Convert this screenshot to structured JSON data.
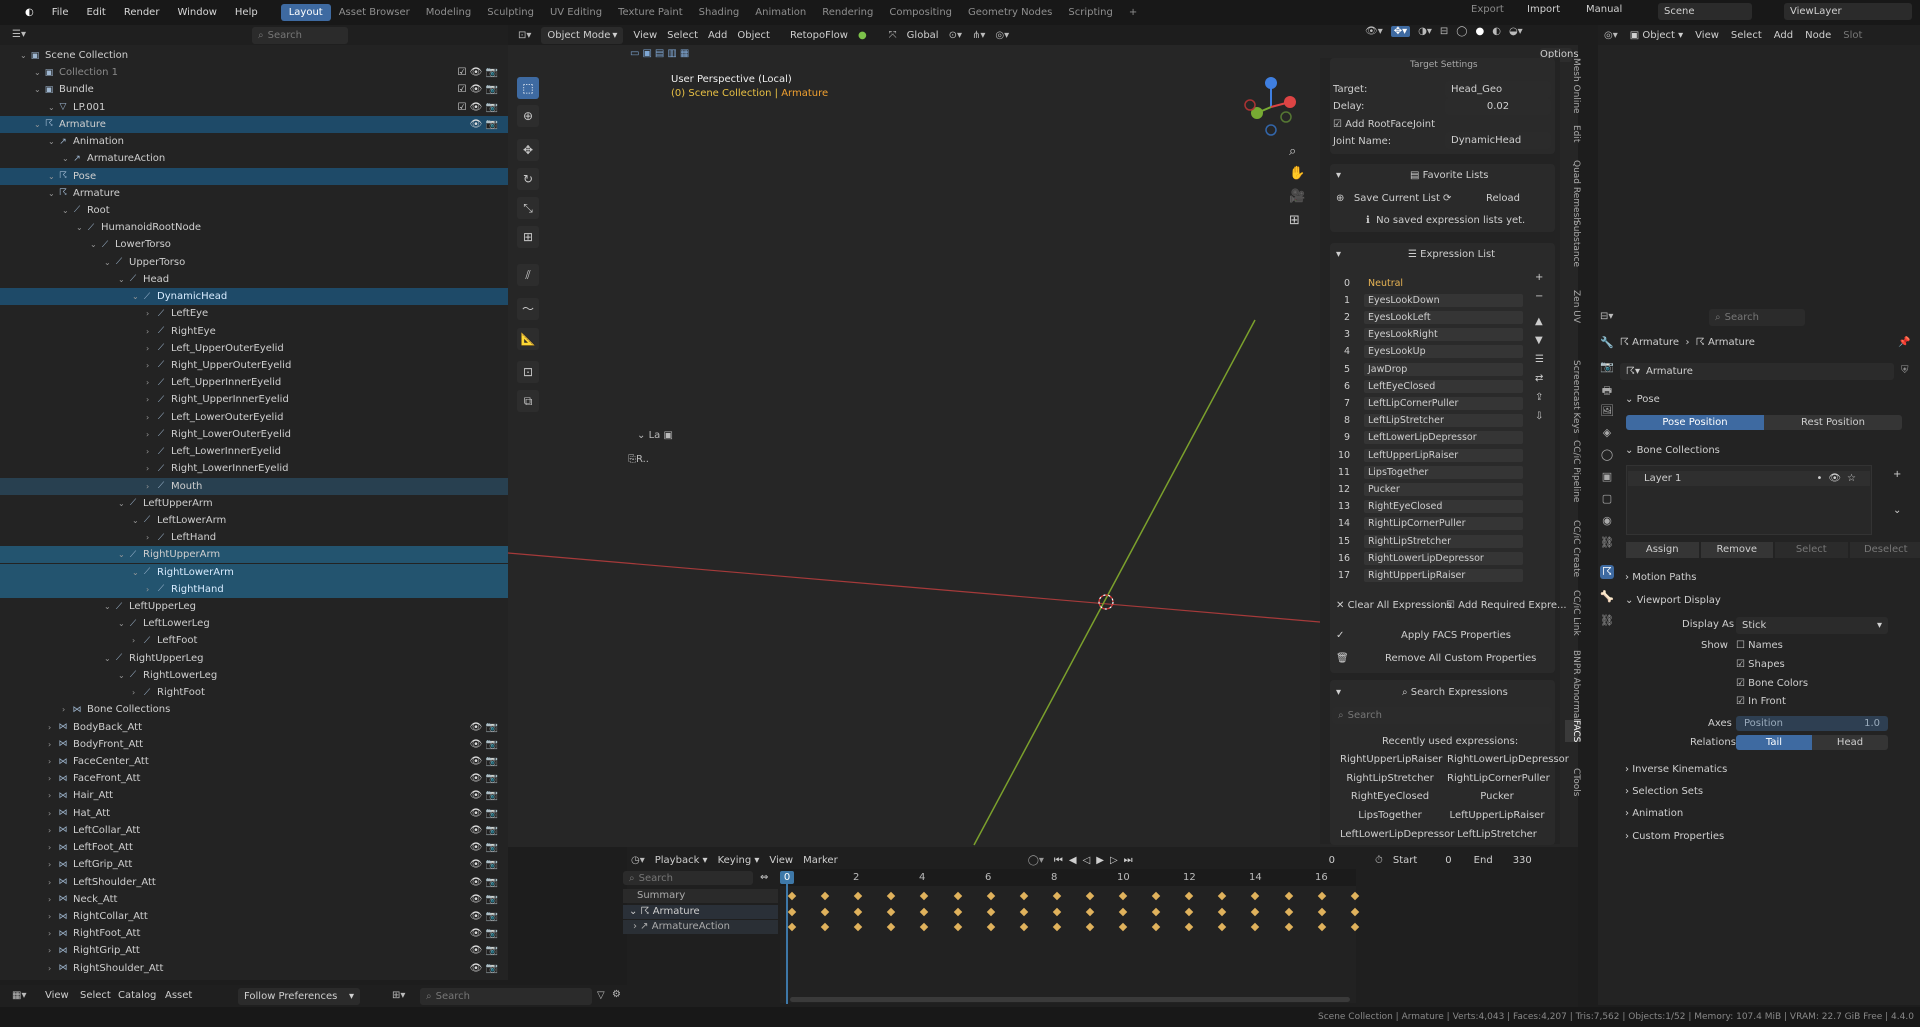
{
  "menu": [
    "File",
    "Edit",
    "Render",
    "Window",
    "Help"
  ],
  "workspaces": [
    "Layout",
    "Asset Browser",
    "Modeling",
    "Sculpting",
    "UV Editing",
    "Texture Paint",
    "Shading",
    "Animation",
    "Rendering",
    "Compositing",
    "Geometry Nodes",
    "Scripting"
  ],
  "topright": {
    "export": "Export",
    "import": "Import",
    "manual": "Manual",
    "scene": "Scene",
    "viewlayer": "ViewLayer"
  },
  "outliner": {
    "search_placeholder": "Search",
    "rows": [
      {
        "label": "Scene Collection",
        "indent": 0
      },
      {
        "label": "Collection 1",
        "indent": 1
      },
      {
        "label": "Bundle",
        "indent": 1
      },
      {
        "label": "LP.001",
        "indent": 2
      },
      {
        "label": "Armature",
        "indent": 1
      },
      {
        "label": "Animation",
        "indent": 2
      },
      {
        "label": "ArmatureAction",
        "indent": 3
      },
      {
        "label": "Pose",
        "indent": 2
      },
      {
        "label": "Armature",
        "indent": 2
      },
      {
        "label": "Root",
        "indent": 3
      },
      {
        "label": "HumanoidRootNode",
        "indent": 4
      },
      {
        "label": "LowerTorso",
        "indent": 5
      },
      {
        "label": "UpperTorso",
        "indent": 6
      },
      {
        "label": "Head",
        "indent": 7
      },
      {
        "label": "DynamicHead",
        "indent": 8
      },
      {
        "label": "LeftEye",
        "indent": 9
      },
      {
        "label": "RightEye",
        "indent": 9
      },
      {
        "label": "Left_UpperOuterEyelid",
        "indent": 9
      },
      {
        "label": "Right_UpperOuterEyelid",
        "indent": 9
      },
      {
        "label": "Left_UpperInnerEyelid",
        "indent": 9
      },
      {
        "label": "Right_UpperInnerEyelid",
        "indent": 9
      },
      {
        "label": "Left_LowerOuterEyelid",
        "indent": 9
      },
      {
        "label": "Right_LowerOuterEyelid",
        "indent": 9
      },
      {
        "label": "Left_LowerInnerEyelid",
        "indent": 9
      },
      {
        "label": "Right_LowerInnerEyelid",
        "indent": 9
      },
      {
        "label": "Mouth",
        "indent": 9
      },
      {
        "label": "LeftUpperArm",
        "indent": 7
      },
      {
        "label": "LeftLowerArm",
        "indent": 8
      },
      {
        "label": "LeftHand",
        "indent": 9
      },
      {
        "label": "RightUpperArm",
        "indent": 7
      },
      {
        "label": "RightLowerArm",
        "indent": 8
      },
      {
        "label": "RightHand",
        "indent": 9
      },
      {
        "label": "LeftUpperLeg",
        "indent": 6
      },
      {
        "label": "LeftLowerLeg",
        "indent": 7
      },
      {
        "label": "LeftFoot",
        "indent": 8
      },
      {
        "label": "RightUpperLeg",
        "indent": 6
      },
      {
        "label": "RightLowerLeg",
        "indent": 7
      },
      {
        "label": "RightFoot",
        "indent": 8
      },
      {
        "label": "Bone Collections",
        "indent": 3
      },
      {
        "label": "BodyBack_Att",
        "indent": 2
      },
      {
        "label": "BodyFront_Att",
        "indent": 2
      },
      {
        "label": "FaceCenter_Att",
        "indent": 2
      },
      {
        "label": "FaceFront_Att",
        "indent": 2
      },
      {
        "label": "Hair_Att",
        "indent": 2
      },
      {
        "label": "Hat_Att",
        "indent": 2
      },
      {
        "label": "LeftCollar_Att",
        "indent": 2
      },
      {
        "label": "LeftFoot_Att",
        "indent": 2
      },
      {
        "label": "LeftGrip_Att",
        "indent": 2
      },
      {
        "label": "LeftShoulder_Att",
        "indent": 2
      },
      {
        "label": "Neck_Att",
        "indent": 2
      },
      {
        "label": "RightCollar_Att",
        "indent": 2
      },
      {
        "label": "RightFoot_Att",
        "indent": 2
      },
      {
        "label": "RightGrip_Att",
        "indent": 2
      },
      {
        "label": "RightShoulder_Att",
        "indent": 2
      }
    ],
    "bottom": {
      "view": "View",
      "select": "Select",
      "catalog": "Catalog",
      "asset": "Asset",
      "follow": "Follow Preferences",
      "search_placeholder": "Search"
    }
  },
  "viewport": {
    "mode": "Object Mode",
    "view": "View",
    "select": "Select",
    "add": "Add",
    "object": "Object",
    "retopo": "RetopoFlow",
    "orientation": "Global",
    "options": "Options",
    "perspective": "User Perspective (Local)",
    "collection": "(0) Scene Collection | ",
    "active": "Armature",
    "la": "La"
  },
  "npanel": {
    "target_settings": "Target Settings",
    "target_label": "Target:",
    "target_value": "Head_Geo",
    "delay_label": "Delay:",
    "delay_value": "0.02",
    "add_root": "Add RootFaceJoint",
    "joint_label": "Joint Name:",
    "joint_value": "DynamicHead",
    "favorite": "Favorite Lists",
    "save_list": "Save Current List",
    "reload": "Reload",
    "no_lists": "No saved expression lists yet.",
    "expr_list": "Expression List",
    "expressions": [
      "Neutral",
      "EyesLookDown",
      "EyesLookLeft",
      "EyesLookRight",
      "EyesLookUp",
      "JawDrop",
      "LeftEyeClosed",
      "LeftLipCornerPuller",
      "LeftLipStretcher",
      "LeftLowerLipDepressor",
      "LeftUpperLipRaiser",
      "LipsTogether",
      "Pucker",
      "RightEyeClosed",
      "RightLipCornerPuller",
      "RightLipStretcher",
      "RightLowerLipDepressor",
      "RightUpperLipRaiser"
    ],
    "clear_all": "Clear All Expressions",
    "add_required": "Add Required Expre...",
    "apply": "Apply FACS Properties",
    "remove_custom": "Remove All Custom Properties",
    "search_expr": "Search Expressions",
    "search_placeholder": "Search",
    "recent": "Recently used expressions:",
    "recent_items": [
      "RightUpperLipRaiser",
      "RightLowerLipDepressor",
      "RightLipStretcher",
      "RightLipCornerPuller",
      "RightEyeClosed",
      "Pucker",
      "LipsTogether",
      "LeftUpperLipRaiser",
      "LeftLowerLipDepressor",
      "LeftLipStretcher"
    ],
    "vtabs": [
      "Mesh Online",
      "Edit",
      "Quad Remesh",
      "Substance",
      "Zen UV",
      "Screencast Keys",
      "CC/iC Pipeline",
      "CC/iC Create",
      "CC/iC Link",
      "BNPR Abnormal",
      "FACS",
      "CTools"
    ]
  },
  "node": {
    "object": "Object",
    "view": "View",
    "select": "Select",
    "add": "Add",
    "node": "Node",
    "slot": "Slot"
  },
  "props": {
    "search_placeholder": "Search",
    "crumb1": "Armature",
    "crumb2": "Armature",
    "name": "Armature",
    "pose": "Pose",
    "pose_position": "Pose Position",
    "rest_position": "Rest Position",
    "bone_collections": "Bone Collections",
    "layer1": "Layer 1",
    "assign": "Assign",
    "remove": "Remove",
    "select": "Select",
    "deselect": "Deselect",
    "motion_paths": "Motion Paths",
    "viewport_display": "Viewport Display",
    "display_as_label": "Display As",
    "display_as": "Stick",
    "show": "Show",
    "names": "Names",
    "shapes": "Shapes",
    "bone_colors": "Bone Colors",
    "in_front": "In Front",
    "axes": "Axes",
    "position": "Position",
    "position_val": "1.0",
    "relations": "Relations",
    "tail": "Tail",
    "head": "Head",
    "inverse_kinematics": "Inverse Kinematics",
    "selection_sets": "Selection Sets",
    "animation": "Animation",
    "custom_properties": "Custom Properties"
  },
  "timeline": {
    "playback": "Playback",
    "keying": "Keying",
    "view": "View",
    "marker": "Marker",
    "current": "0",
    "start_label": "Start",
    "start": "0",
    "end_label": "End",
    "end": "330",
    "search_placeholder": "Search",
    "summary": "Summary",
    "armature": "Armature",
    "action": "ArmatureAction",
    "ticks": [
      "0",
      "2",
      "4",
      "6",
      "8",
      "10",
      "12",
      "14",
      "16"
    ]
  },
  "status": "Scene Collection | Armature | Verts:4,043 | Faces:4,207 | Tris:7,562 | Objects:1/52 | Memory: 107.4 MiB | VRAM: 22.7 GiB Free | 4.4.0"
}
